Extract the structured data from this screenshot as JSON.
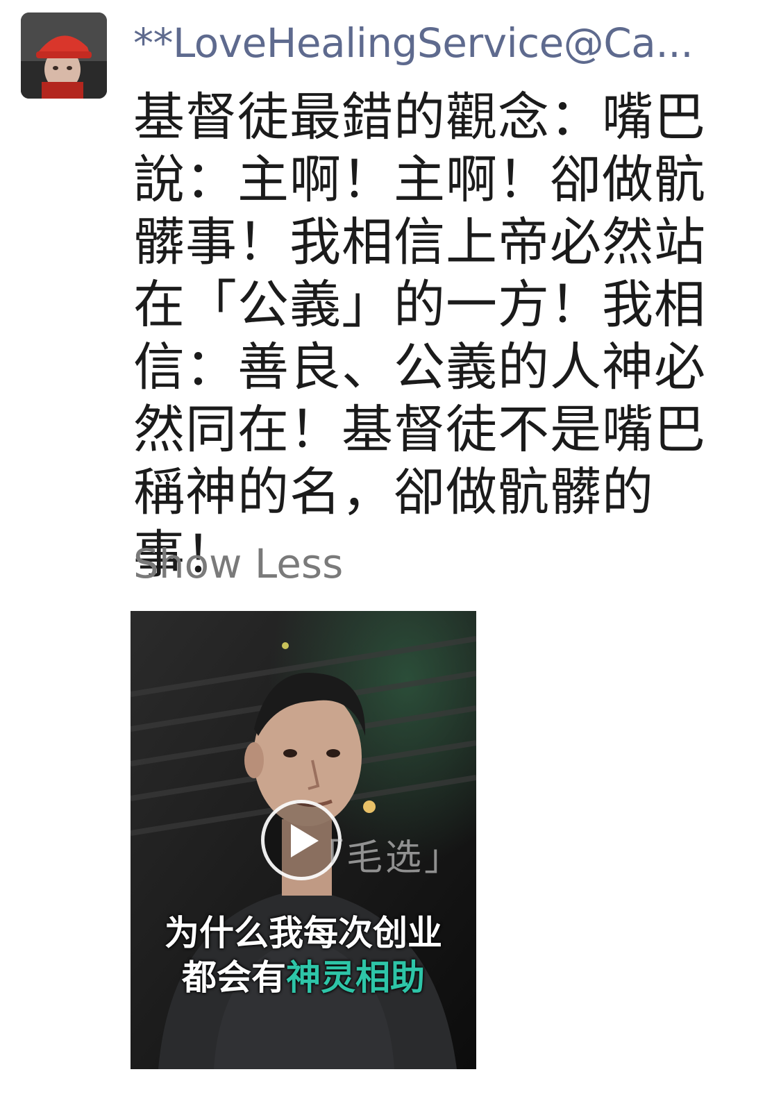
{
  "author": {
    "name": "**LoveHealingService@Ca..."
  },
  "post": {
    "text": "基督徒最錯的觀念：嘴巴說：主啊！主啊！卻做骯髒事！我相信上帝必然站在「公義」的一方！我相信：善良、公義的人神必然同在！基督徒不是嘴巴稱神的名，卻做骯髒的事！",
    "show_less_label": "Show Less"
  },
  "video": {
    "overlay_tag": "「毛选」",
    "caption_line1": "为什么我每次创业",
    "caption_line2_prefix": "都会有",
    "caption_line2_highlight": "神灵相助",
    "highlight_color": "#2ec5a8"
  },
  "colors": {
    "author_name": "#5e6a8e",
    "body_text": "#1b1b1b",
    "show_less": "#7a7a7a"
  },
  "icons": {
    "avatar": "user-avatar-red-cap",
    "play": "play-icon"
  }
}
